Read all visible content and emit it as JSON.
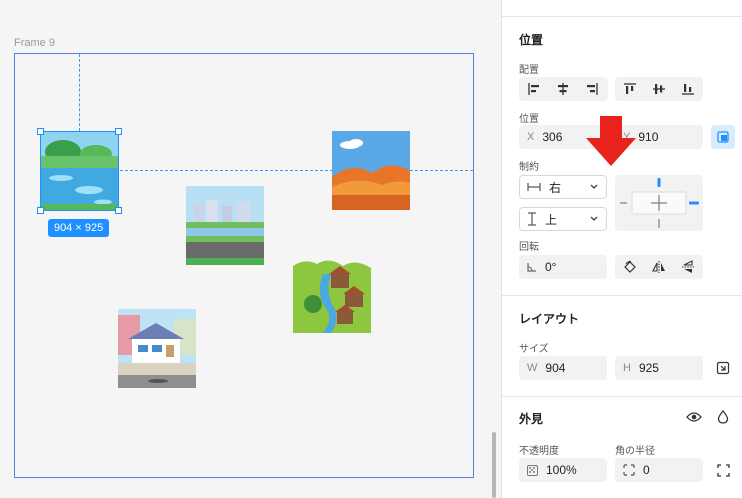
{
  "canvas": {
    "frame_label": "Frame 9",
    "selection_size": "904 × 925"
  },
  "panel": {
    "position": {
      "title": "位置",
      "align_label": "配置",
      "pos_label": "位置",
      "x_prefix": "X",
      "x_value": "306",
      "y_prefix": "Y",
      "y_value": "910",
      "constraints_label": "制約",
      "h_constraint": "右",
      "v_constraint": "上",
      "rotation_label": "回転",
      "rotation_value": "0°"
    },
    "layout": {
      "title": "レイアウト",
      "size_label": "サイズ",
      "w_prefix": "W",
      "w_value": "904",
      "h_prefix": "H",
      "h_value": "925"
    },
    "appearance": {
      "title": "外見",
      "opacity_label": "不透明度",
      "opacity_value": "100%",
      "radius_label": "角の半径",
      "radius_value": "0"
    }
  },
  "colors": {
    "accent": "#1e90ff",
    "frame_border": "#5b7fe0",
    "annotation_arrow": "#e8231c"
  },
  "icons": [
    "align-left-icon",
    "align-center-h-icon",
    "align-right-icon",
    "align-top-icon",
    "align-center-v-icon",
    "align-bottom-icon",
    "position-mode-icon",
    "horizontal-constraint-icon",
    "vertical-constraint-icon",
    "chevron-down-icon",
    "rotation-angle-icon",
    "rotate-icon",
    "flip-horizontal-icon",
    "flip-vertical-icon",
    "resize-icon",
    "eye-icon",
    "drop-icon",
    "opacity-icon",
    "corner-radius-icon",
    "independent-corners-icon"
  ]
}
